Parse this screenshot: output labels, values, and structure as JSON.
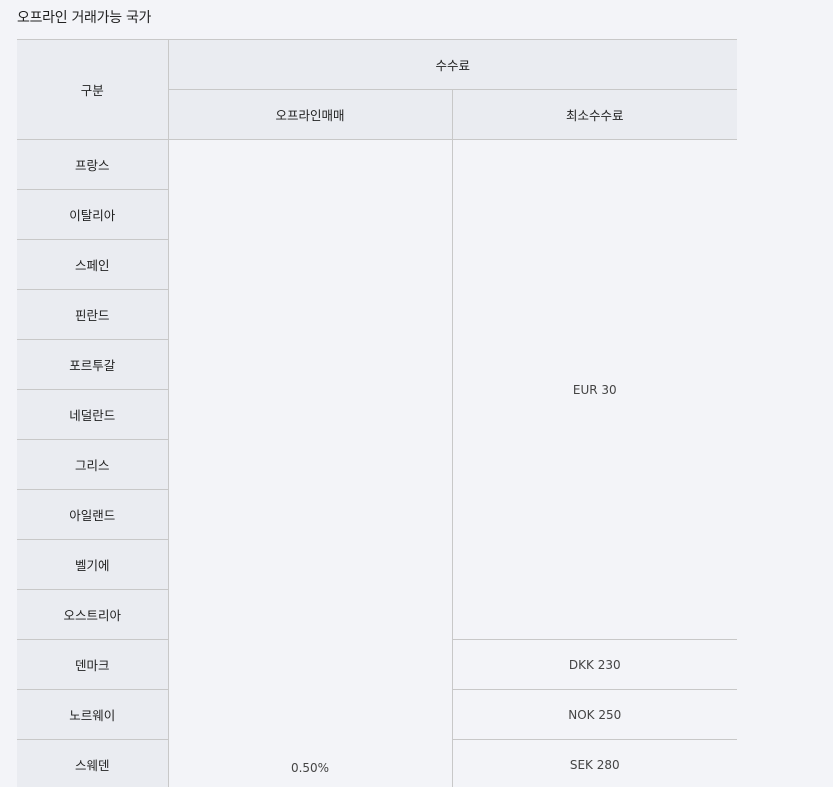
{
  "section": {
    "title": "오프라인 거래가능 국가"
  },
  "table": {
    "header": {
      "category": "구분",
      "fees": "수수료",
      "offline_trading": "오프라인매매",
      "minimum_fee": "최소수수료"
    },
    "countries": [
      "프랑스",
      "이탈리아",
      "스페인",
      "핀란드",
      "포르투갈",
      "네덜란드",
      "그리스",
      "아일랜드",
      "벨기에",
      "오스트리아",
      "덴마크",
      "노르웨이",
      "스웨덴"
    ],
    "offline_rate": "0.50%",
    "min_fees": {
      "eur": "EUR 30",
      "dkk": "DKK 230",
      "nok": "NOK 250",
      "sek": "SEK 280"
    }
  }
}
